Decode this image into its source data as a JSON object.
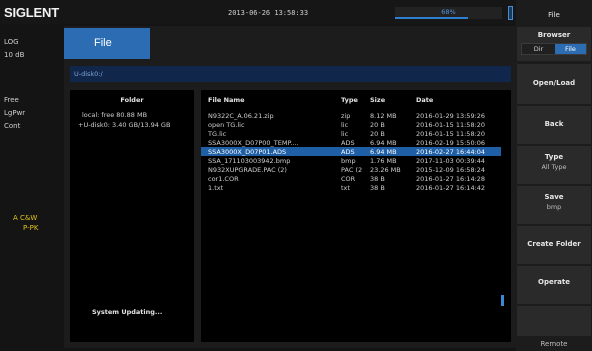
{
  "brand": "SIGLENT",
  "datetime": "2013-06-26  13:58:33",
  "progress": {
    "text": "68%",
    "value": 0.68
  },
  "left": {
    "log": "LOG",
    "scale": "10 dB",
    "free": "Free",
    "lgpwr": "LgPwr",
    "cont": "Cont",
    "marker_a": "A C&W",
    "marker_p": "P-PK"
  },
  "window": {
    "tab": "File",
    "path": "U-disk0:/",
    "folder_header": "Folder",
    "folders": [
      "local: free 80.88 MB",
      "+U-disk0: 3.40 GB/13.94 GB"
    ],
    "status": "System Updating..."
  },
  "files": {
    "headers": {
      "name": "File Name",
      "type": "Type",
      "size": "Size",
      "date": "Date"
    },
    "rows": [
      {
        "name": "N9322C_A.06.21.zip",
        "type": "zip",
        "size": "8.12 MB",
        "date": "2016-01-29 13:59:26"
      },
      {
        "name": "open TG.lic",
        "type": "lic",
        "size": "20 B",
        "date": "2016-01-15 11:58:20"
      },
      {
        "name": "TG.lic",
        "type": "lic",
        "size": "20 B",
        "date": "2016-01-15 11:58:20"
      },
      {
        "name": "SSA3000X_D07P00_TEMP....",
        "type": "ADS",
        "size": "6.94 MB",
        "date": "2016-02-19 15:50:06"
      },
      {
        "name": "SSA3000X_D07P01.ADS",
        "type": "ADS",
        "size": "6.94 MB",
        "date": "2016-02-27 16:44:04"
      },
      {
        "name": "SSA_171103003942.bmp",
        "type": "bmp",
        "size": "1.76 MB",
        "date": "2017-11-03 00:39:44"
      },
      {
        "name": "N932XUPGRADE.PAC (2)",
        "type": "PAC (2",
        "size": "23.26 MB",
        "date": "2015-12-09 16:58:24"
      },
      {
        "name": "cor1.COR",
        "type": "COR",
        "size": "38 B",
        "date": "2016-01-27 16:14:28"
      },
      {
        "name": "1.txt",
        "type": "txt",
        "size": "38 B",
        "date": "2016-01-27 16:14:42"
      }
    ],
    "selected_index": 4
  },
  "softkeys": {
    "title": "File",
    "browser": {
      "label": "Browser",
      "left": "Dir",
      "right": "File",
      "active": "File"
    },
    "open_load": "Open/Load",
    "back": "Back",
    "type": {
      "label": "Type",
      "value": "All Type"
    },
    "save": {
      "label": "Save",
      "value": "bmp"
    },
    "create_folder": "Create Folder",
    "operate": "Operate",
    "remote": "Remote"
  },
  "colors": {
    "accent": "#2b6cb2",
    "marker": "#e4c21b",
    "selected_row": "#1e5fa6"
  }
}
